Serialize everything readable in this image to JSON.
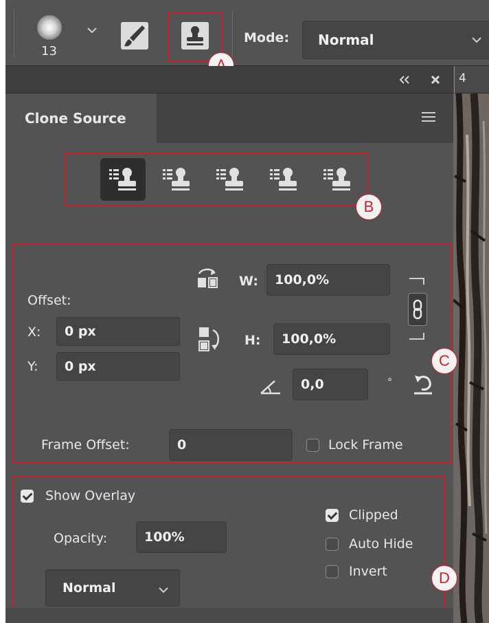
{
  "toolbar": {
    "brush_size": "13",
    "mode_label": "Mode:",
    "mode_value": "Normal",
    "callout_a": "A"
  },
  "panel": {
    "tab_title": "Clone Source",
    "ruler_number": "4",
    "callout_b": "B",
    "callout_c": "C",
    "callout_d": "D",
    "offset_label": "Offset:",
    "x_label": "X:",
    "x_value": "0 px",
    "y_label": "Y:",
    "y_value": "0 px",
    "w_label": "W:",
    "w_value": "100,0%",
    "h_label": "H:",
    "h_value": "100,0%",
    "angle_value": "0,0",
    "degree_symbol": "°",
    "frame_offset_label": "Frame Offset:",
    "frame_offset_value": "0",
    "lock_frame_label": "Lock Frame",
    "lock_frame_checked": false,
    "show_overlay_label": "Show Overlay",
    "show_overlay_checked": true,
    "opacity_label": "Opacity:",
    "opacity_value": "100%",
    "blend_mode": "Normal",
    "clipped_label": "Clipped",
    "clipped_checked": true,
    "auto_hide_label": "Auto Hide",
    "auto_hide_checked": false,
    "invert_label": "Invert",
    "invert_checked": false,
    "active_source_index": 1,
    "source_count": 5
  }
}
